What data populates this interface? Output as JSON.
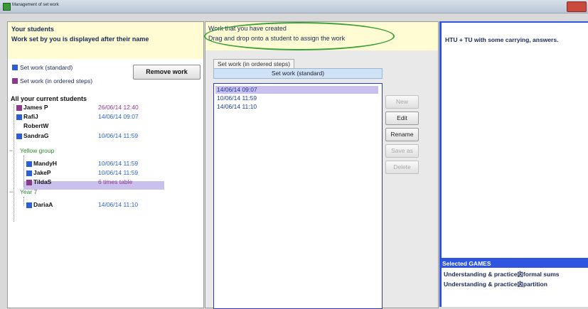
{
  "window": {
    "title": "Management of set work"
  },
  "left": {
    "header_line1": "Your students",
    "header_line2": "Work set by you is displayed after their name",
    "legend_standard": "Set work (standard)",
    "legend_ordered": "Set work (in ordered steps)",
    "remove_button": "Remove work",
    "students_title": "All your current students",
    "students": [
      {
        "name": "James P",
        "date": "26/06/14  12:40"
      },
      {
        "name": "RafiJ",
        "date": "14/06/14  09:07"
      },
      {
        "name": "RobertW",
        "date": ""
      },
      {
        "name": "SandraG",
        "date": "10/06/14  11:59"
      },
      {
        "name": "MandyH",
        "date": "10/06/14  11:59"
      },
      {
        "name": "JakeP",
        "date": "10/06/14  11:59"
      },
      {
        "name": "TildaS",
        "date": "6 times table"
      },
      {
        "name": "DariaA",
        "date": "14/06/14  11:10"
      }
    ],
    "groups": [
      "Yellow group",
      "Year 7"
    ]
  },
  "middle": {
    "header_line1": "Work that you have created",
    "header_line2": "Drag and drop onto a student to assign the work",
    "tab_ordered": "Set work (in ordered steps)",
    "tab_standard": "Set work (standard)",
    "items": [
      "14/06/14  09:07",
      "10/06/14  11:59",
      "14/06/14  11:10"
    ],
    "buttons": {
      "new": "New",
      "edit": "Edit",
      "rename": "Rename",
      "save_as": "Save as",
      "delete": "Delete"
    }
  },
  "right": {
    "description": "HTU + TU with some carrying, answers.",
    "selected_games_label": "Selected GAMES",
    "games": [
      "Understanding & practice囟formal sums",
      "Understanding & practice囟partition"
    ]
  },
  "colors": {
    "standard": "#2a5fd8",
    "ordered": "#8a3a8a",
    "group": "#2a8a2a",
    "accent": "#2f55e0"
  }
}
